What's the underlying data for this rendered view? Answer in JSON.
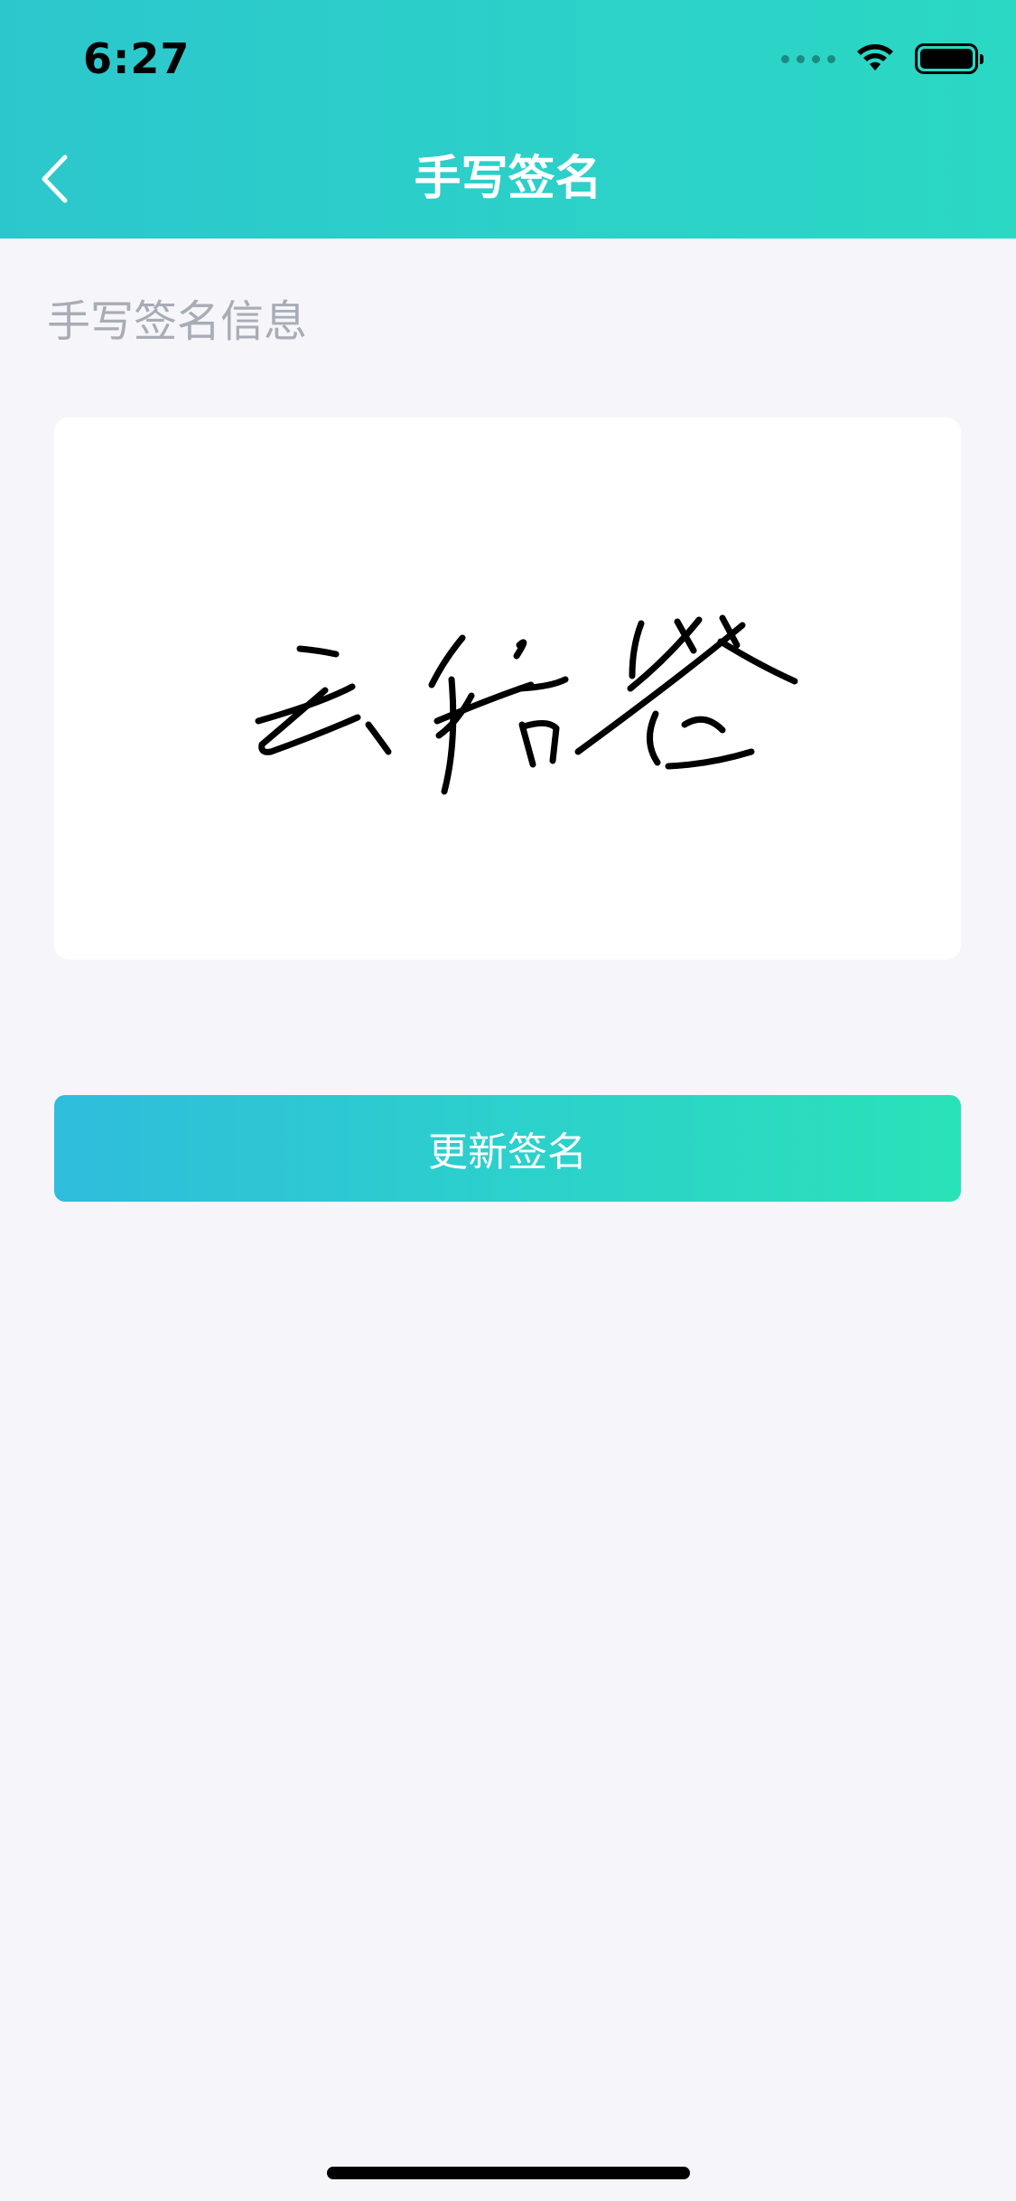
{
  "status_bar": {
    "time": "6:27",
    "icons": [
      "cellular-signal-icon",
      "wifi-icon",
      "battery-icon"
    ]
  },
  "nav": {
    "title": "手写签名",
    "back_icon": "chevron-left-icon"
  },
  "section": {
    "label": "手写签名信息"
  },
  "signature": {
    "text": "云信签",
    "ink_color": "#000000"
  },
  "actions": {
    "update_label": "更新签名"
  },
  "colors": {
    "header_start": "#2cc7cd",
    "header_end": "#2bd8c4",
    "button_start": "#2fbddc",
    "button_end": "#2ae2b8",
    "background": "#f5f5fa",
    "label_gray": "#a8acb6"
  }
}
